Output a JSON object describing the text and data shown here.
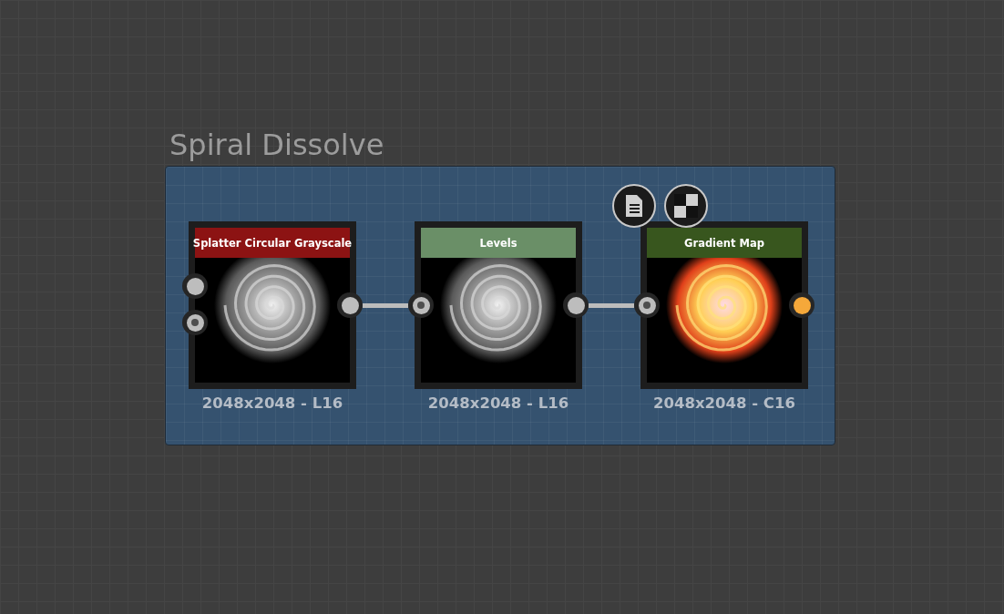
{
  "frame": {
    "title": "Spiral Dissolve"
  },
  "nodes": [
    {
      "title": "Splatter Circular Grayscale",
      "color": "#8c1313",
      "kind": "grayscale",
      "resolution": "2048x2048 - L16",
      "inputs": [
        {
          "kind": "plain"
        },
        {
          "kind": "dotted"
        }
      ],
      "output": {
        "color": "#bdbdbd"
      }
    },
    {
      "title": "Levels",
      "color": "#6a8f67",
      "kind": "grayscale",
      "resolution": "2048x2048 - L16",
      "inputs": [
        {
          "kind": "dotted"
        }
      ],
      "output": {
        "color": "#bdbdbd"
      }
    },
    {
      "title": "Gradient Map",
      "color": "#38561e",
      "kind": "color",
      "resolution": "2048x2048 - C16",
      "inputs": [
        {
          "kind": "dotted"
        }
      ],
      "output": {
        "color": "#f5a83a"
      },
      "badges": [
        {
          "kind": "document"
        },
        {
          "kind": "checker"
        }
      ]
    }
  ]
}
